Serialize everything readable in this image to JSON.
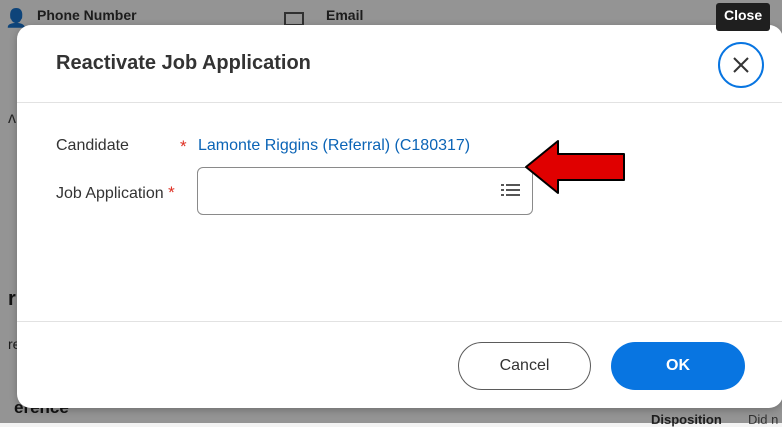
{
  "background": {
    "phone_label": "Phone Number",
    "email_label": "Email",
    "fragment_1": "ʌ",
    "fragment_2": "r",
    "fragment_3": "re",
    "reference_label": "erence",
    "disposition_label": "Disposition",
    "did_not_label": "Did n"
  },
  "tooltip": {
    "close": "Close"
  },
  "dialog": {
    "title": "Reactivate Job Application",
    "candidate_label": "Candidate",
    "candidate_required": "*",
    "candidate_value": "Lamonte Riggins (Referral) (C180317)",
    "job_application_label": "Job Application",
    "job_application_required": "*",
    "job_application_value": "",
    "prompt_icon": "list-prompt-icon",
    "cancel_label": "Cancel",
    "ok_label": "OK"
  },
  "colors": {
    "accent": "#0875e1",
    "link": "#0b64b6",
    "required": "#de2e21",
    "annotation_arrow": "#e00000"
  }
}
